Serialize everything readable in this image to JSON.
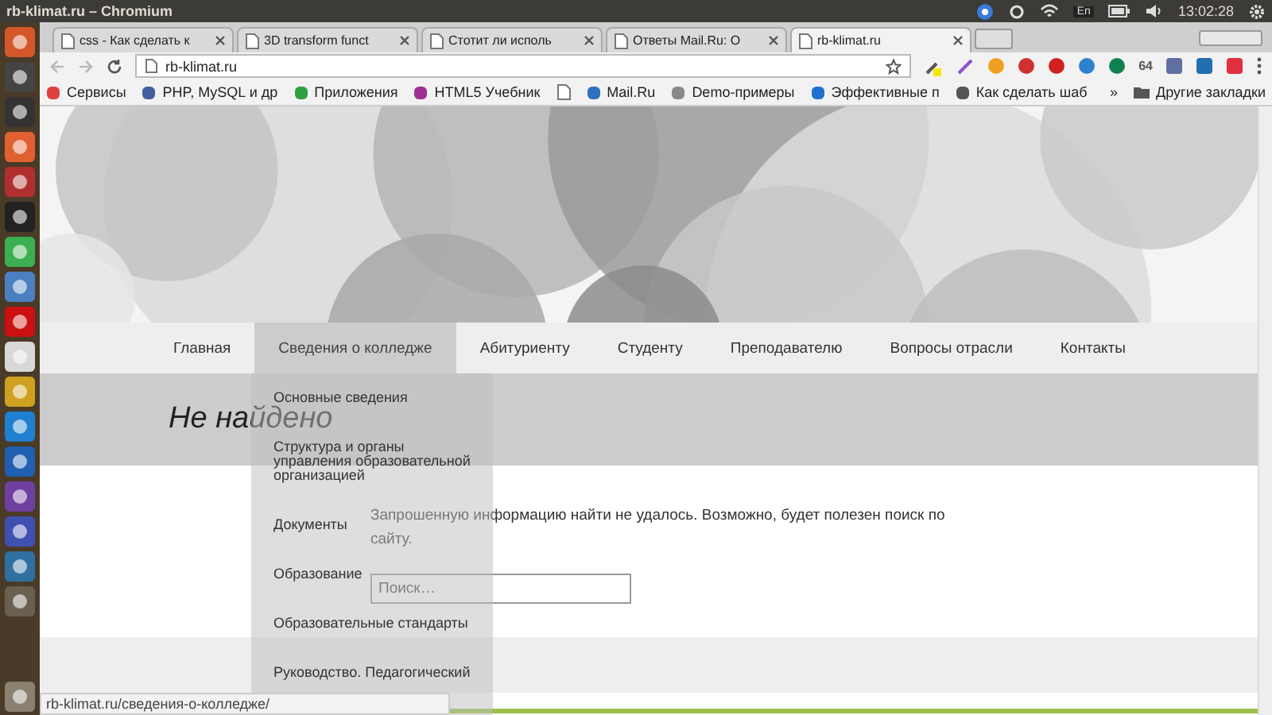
{
  "top_bar": {
    "title": "rb-klimat.ru – Chromium",
    "keyboard_layout": "En",
    "time": "13:02:28"
  },
  "tabs": [
    {
      "title": "css - Как сделать к",
      "selected": false
    },
    {
      "title": "3D transform funct",
      "selected": false
    },
    {
      "title": "Стотит ли исполь",
      "selected": false
    },
    {
      "title": "Ответы Mail.Ru: О",
      "selected": false
    },
    {
      "title": "rb-klimat.ru",
      "selected": true
    }
  ],
  "address_bar": {
    "url": "rb-klimat.ru"
  },
  "extension_label": "64",
  "bookmarks": [
    {
      "kind": "link",
      "label": "Сервисы"
    },
    {
      "kind": "link",
      "label": "PHP, MySQL и др"
    },
    {
      "kind": "link",
      "label": "Приложения"
    },
    {
      "kind": "link",
      "label": "HTML5 Учебник"
    },
    {
      "kind": "icon"
    },
    {
      "kind": "link",
      "label": "Mail.Ru"
    },
    {
      "kind": "link",
      "label": "Demo-примеры"
    },
    {
      "kind": "link",
      "label": "Эффективные п"
    },
    {
      "kind": "link",
      "label": "Как сделать шаб"
    }
  ],
  "bookmarks_overflow": "»",
  "other_bookmarks": "Другие закладки",
  "nav": [
    {
      "label": "Главная",
      "selected": false
    },
    {
      "label": "Сведения о колледже",
      "selected": true
    },
    {
      "label": "Абитуриенту",
      "selected": false
    },
    {
      "label": "Студенту",
      "selected": false
    },
    {
      "label": "Преподавателю",
      "selected": false
    },
    {
      "label": "Вопросы отрасли",
      "selected": false
    },
    {
      "label": "Контакты",
      "selected": false
    }
  ],
  "dropdown": [
    "Основные сведения",
    "Структура и органы управления образовательной организацией",
    "Документы",
    "Образование",
    "Образовательные стандарты",
    "Руководство. Педагогический"
  ],
  "page_title": "Не найдено",
  "message": "Запрошенную информацию найти не удалось. Возможно, будет полезен поиск по сайту.",
  "search": {
    "placeholder": "Поиск…"
  },
  "status_url": "rb-klimat.ru/сведения-о-колледже/"
}
